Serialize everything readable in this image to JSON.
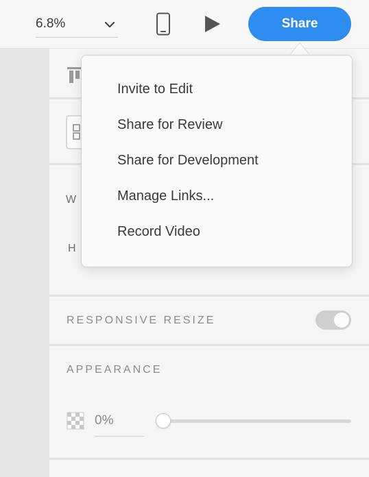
{
  "toolbar": {
    "zoom_value": "6.8%",
    "device_icon": "mobile-device-icon",
    "play_icon": "play-icon",
    "share_label": "Share",
    "share_color": "#2d8ced"
  },
  "share_menu": {
    "items": [
      {
        "label": "Invite to Edit"
      },
      {
        "label": "Share for Review"
      },
      {
        "label": "Share for Development"
      },
      {
        "label": "Manage Links..."
      },
      {
        "label": "Record Video"
      }
    ]
  },
  "panel": {
    "w_label": "W",
    "h_label": "H",
    "responsive_resize": {
      "label": "RESPONSIVE RESIZE",
      "enabled": false
    },
    "appearance": {
      "label": "APPEARANCE",
      "opacity_value": "0%",
      "opacity_fraction": 0.0
    }
  }
}
